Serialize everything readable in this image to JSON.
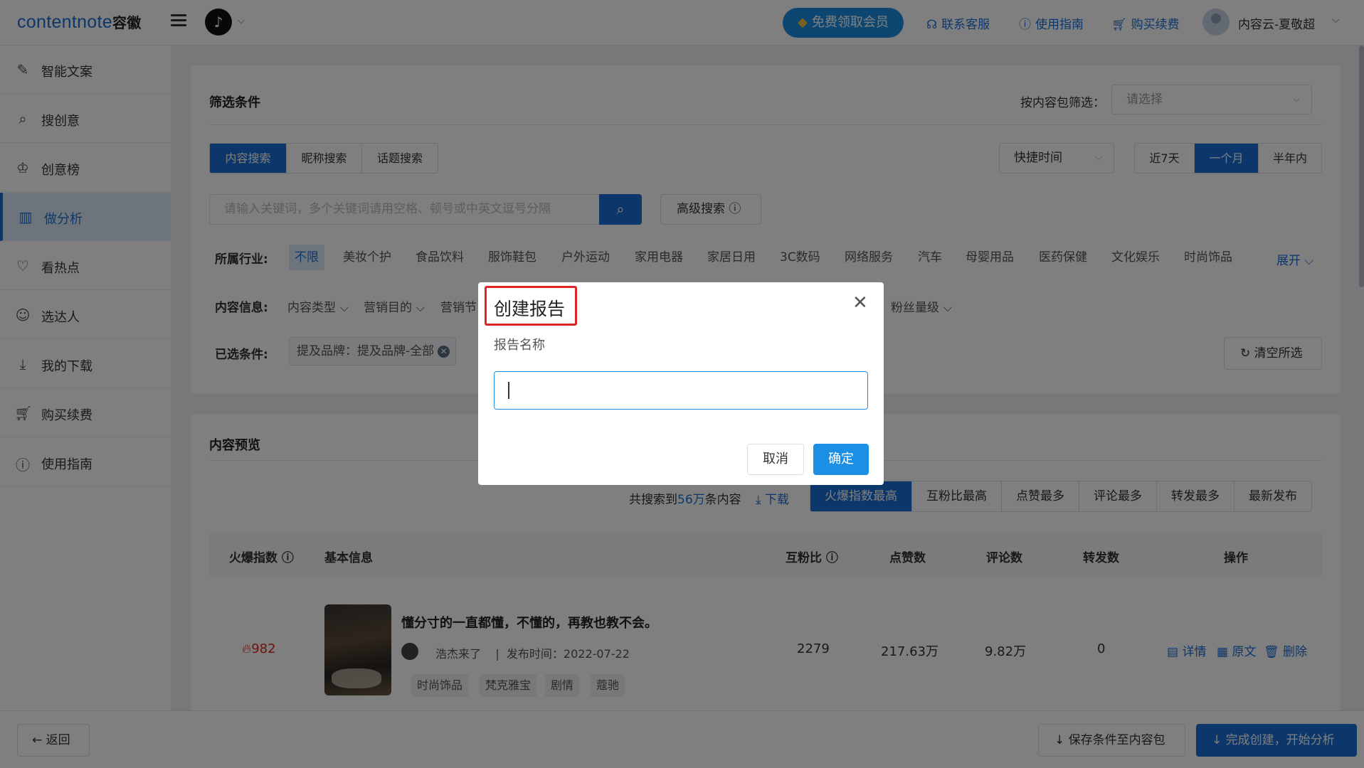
{
  "header": {
    "logo_text": "contentnote",
    "logo_cn": "容徽",
    "vip_label": "免费领取会员",
    "links": [
      {
        "label": "联系客服",
        "icon": "headset-icon"
      },
      {
        "label": "使用指南",
        "icon": "help-circle-icon"
      },
      {
        "label": "购买续费",
        "icon": "cart-icon"
      }
    ],
    "user_name": "内容云-夏敬超"
  },
  "sidebar": {
    "items": [
      {
        "label": "智能文案",
        "icon": "ai-writing-icon",
        "active": false
      },
      {
        "label": "搜创意",
        "icon": "search-creative-icon",
        "active": false
      },
      {
        "label": "创意榜",
        "icon": "ranking-icon",
        "active": false
      },
      {
        "label": "做分析",
        "icon": "bar-chart-icon",
        "active": true
      },
      {
        "label": "看热点",
        "icon": "heartbeat-icon",
        "active": false
      },
      {
        "label": "选达人",
        "icon": "person-icon",
        "active": false
      },
      {
        "label": "我的下载",
        "icon": "download-icon",
        "active": false
      },
      {
        "label": "购买续费",
        "icon": "cart-icon",
        "active": false
      },
      {
        "label": "使用指南",
        "icon": "help-circle-icon",
        "active": false
      }
    ]
  },
  "filters": {
    "title": "筛选条件",
    "package_label": "按内容包筛选：",
    "package_placeholder": "请选择",
    "search_tabs": [
      "内容搜索",
      "昵称搜索",
      "话题搜索"
    ],
    "time_select": "快捷时间",
    "time_tabs": [
      "近7天",
      "一个月",
      "半年内"
    ],
    "search_placeholder": "请输入关键词，多个关键词请用空格、顿号或中英文逗号分隔",
    "advanced_label": "高级搜索",
    "industry_label": "所属行业:",
    "industries": [
      "不限",
      "美妆个护",
      "食品饮料",
      "服饰鞋包",
      "户外运动",
      "家用电器",
      "家居日用",
      "3C数码",
      "网络服务",
      "汽车",
      "母婴用品",
      "医药保健",
      "文化娱乐",
      "时尚饰品"
    ],
    "expand_label": "展开",
    "content_info_label": "内容信息:",
    "content_dropdowns": [
      "内容类型",
      "营销目的",
      "营销节",
      "粉丝量级"
    ],
    "selected_label": "已选条件:",
    "selected_chip": "提及品牌：提及品牌-全部",
    "clear_label": "清空所选"
  },
  "preview": {
    "title": "内容预览",
    "total_prefix": "共搜索到",
    "total_count": "56万",
    "total_suffix": "条内容",
    "download_label": "下载",
    "sort_tabs": [
      "火爆指数最高",
      "互粉比最高",
      "点赞最多",
      "评论最多",
      "转发最多",
      "最新发布"
    ],
    "columns": [
      "火爆指数",
      "基本信息",
      "互粉比",
      "点赞数",
      "评论数",
      "转发数",
      "操作"
    ],
    "row": {
      "hot": "982",
      "title": "懂分寸的一直都懂，不懂的，再教也教不会。",
      "author": "浩杰来了",
      "publish": "发布时间：2022-07-22",
      "tags": [
        "时尚饰品",
        "梵克雅宝",
        "剧情",
        "蔻驰"
      ],
      "ratio": "2279",
      "likes": "217.63万",
      "comments": "9.82万",
      "shares": "0",
      "ops": [
        "详情",
        "原文",
        "删除"
      ]
    }
  },
  "footer": {
    "back_label": "返回",
    "save_label": "保存条件至内容包",
    "finish_label": "完成创建，开始分析"
  },
  "modal": {
    "title": "创建报告",
    "field_label": "报告名称",
    "input_value": "",
    "cancel_label": "取消",
    "ok_label": "确定"
  }
}
